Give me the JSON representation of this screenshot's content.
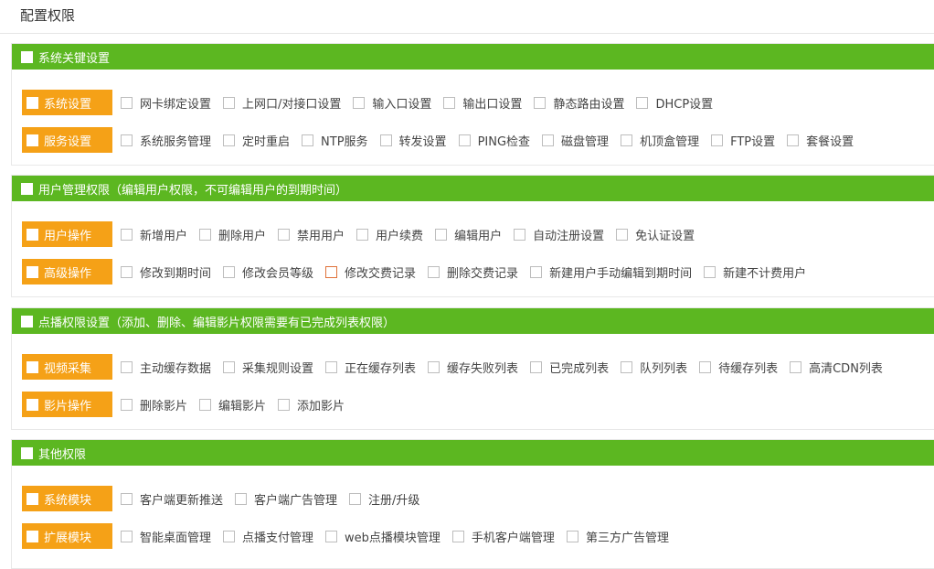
{
  "page": {
    "title": "配置权限"
  },
  "sections": [
    {
      "title": "系统关键设置",
      "groups": [
        {
          "label": "系统设置",
          "items": [
            "网卡绑定设置",
            "上网口/对接口设置",
            "输入口设置",
            "输出口设置",
            "静态路由设置",
            "DHCP设置"
          ]
        },
        {
          "label": "服务设置",
          "items": [
            "系统服务管理",
            "定时重启",
            "NTP服务",
            "转发设置",
            "PING检查",
            "磁盘管理",
            "机顶盒管理",
            "FTP设置",
            "套餐设置"
          ]
        }
      ]
    },
    {
      "title": "用户管理权限（编辑用户权限，不可编辑用户的到期时间）",
      "groups": [
        {
          "label": "用户操作",
          "items": [
            "新增用户",
            "删除用户",
            "禁用用户",
            "用户续费",
            "编辑用户",
            "自动注册设置",
            "免认证设置"
          ]
        },
        {
          "label": "高级操作",
          "items": [
            "修改到期时间",
            "修改会员等级",
            "修改交费记录",
            "删除交费记录",
            "新建用户手动编辑到期时间",
            "新建不计费用户"
          ]
        }
      ]
    },
    {
      "title": "点播权限设置（添加、删除、编辑影片权限需要有已完成列表权限）",
      "groups": [
        {
          "label": "视频采集",
          "items": [
            "主动缓存数据",
            "采集规则设置",
            "正在缓存列表",
            "缓存失败列表",
            "已完成列表",
            "队列列表",
            "待缓存列表",
            "高清CDN列表"
          ]
        },
        {
          "label": "影片操作",
          "items": [
            "删除影片",
            "编辑影片",
            "添加影片"
          ]
        }
      ]
    },
    {
      "title": "其他权限",
      "groups": [
        {
          "label": "系统模块",
          "items": [
            "客户端更新推送",
            "客户端广告管理",
            "注册/升级"
          ]
        },
        {
          "label": "扩展模块",
          "items": [
            "智能桌面管理",
            "点播支付管理",
            "web点播模块管理",
            "手机客户端管理",
            "第三方广告管理"
          ]
        }
      ]
    }
  ],
  "colors": {
    "header_green": "#5cb721",
    "group_orange": "#f5a117",
    "focus_checkbox": "#e0723a"
  }
}
